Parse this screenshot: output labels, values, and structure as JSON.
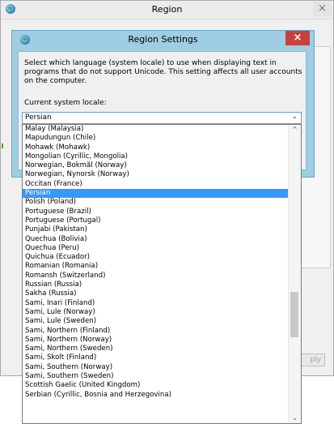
{
  "outer_window": {
    "title": "Region",
    "close_glyph": "×",
    "apply_label_partial": "ply"
  },
  "dialog": {
    "title": "Region Settings",
    "close_glyph": "×",
    "description": "Select which language (system locale) to use when displaying text in programs that do not support Unicode. This setting affects all user accounts on the computer.",
    "current_label": "Current system locale:",
    "combo_value": "Persian",
    "combo_arrow": "⌄"
  },
  "locale_list": {
    "selected": "Persian",
    "scroll_up": "^",
    "scroll_down": "⌄",
    "items": [
      "Malay (Malaysia)",
      "Mapudungun (Chile)",
      "Mohawk (Mohawk)",
      "Mongolian (Cyrillic, Mongolia)",
      "Norwegian, Bokmål (Norway)",
      "Norwegian, Nynorsk (Norway)",
      "Occitan (France)",
      "Persian",
      "Polish (Poland)",
      "Portuguese (Brazil)",
      "Portuguese (Portugal)",
      "Punjabi (Pakistan)",
      "Quechua (Bolivia)",
      "Quechua (Peru)",
      "Quichua (Ecuador)",
      "Romanian (Romania)",
      "Romansh (Switzerland)",
      "Russian (Russia)",
      "Sakha (Russia)",
      "Sami, Inari (Finland)",
      "Sami, Lule (Norway)",
      "Sami, Lule (Sweden)",
      "Sami, Northern (Finland)",
      "Sami, Northern (Norway)",
      "Sami, Northern (Sweden)",
      "Sami, Skolt (Finland)",
      "Sami, Southern (Norway)",
      "Sami, Southern (Sweden)",
      "Scottish Gaelic (United Kingdom)",
      "Serbian (Cyrillic, Bosnia and Herzegovina)"
    ]
  },
  "colors": {
    "selection": "#3399ff",
    "dialog_frame": "#9fcde3",
    "close_red": "#c7413c"
  }
}
